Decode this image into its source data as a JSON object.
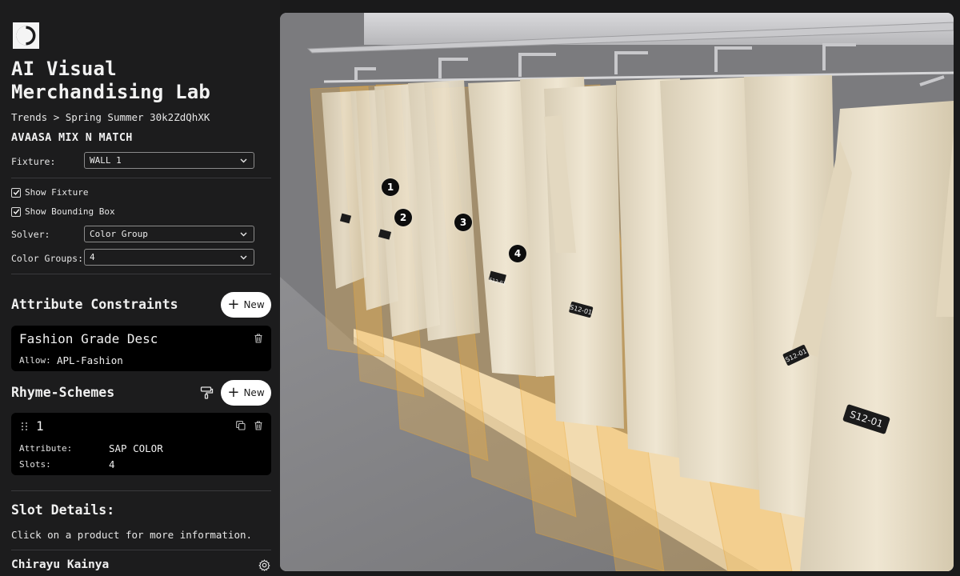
{
  "app": {
    "title": "AI Visual Merchandising Lab",
    "logo_icon": "half-circle-logo"
  },
  "breadcrumb": {
    "parent": "Trends",
    "separator": ">",
    "current": "Spring Summer 30k2ZdQhXK"
  },
  "collection": {
    "name": "AVAASA MIX N MATCH"
  },
  "controls": {
    "fixture_label": "Fixture:",
    "fixture_value": "WALL 1",
    "show_fixture_label": "Show Fixture",
    "show_fixture_checked": true,
    "show_bbox_label": "Show Bounding Box",
    "show_bbox_checked": true,
    "solver_label": "Solver:",
    "solver_value": "Color Group",
    "color_groups_label": "Color Groups:",
    "color_groups_value": "4"
  },
  "attribute_constraints": {
    "title": "Attribute Constraints",
    "new_label": "New",
    "items": [
      {
        "name": "Fashion Grade Desc",
        "allow_label": "Allow:",
        "allow_value": "APL-Fashion"
      }
    ]
  },
  "rhyme_schemes": {
    "title": "Rhyme-Schemes",
    "new_label": "New",
    "items": [
      {
        "index": "1",
        "attribute_label": "Attribute:",
        "attribute_value": "SAP COLOR",
        "slots_label": "Slots:",
        "slots_value": "4"
      }
    ]
  },
  "slot_details": {
    "title": "Slot Details:",
    "hint": "Click on a product for more information."
  },
  "user": {
    "name": "Chirayu Kainya"
  },
  "viewport": {
    "markers": [
      "1",
      "2",
      "3",
      "4"
    ],
    "tags": [
      "S12-01",
      "S12-01",
      "S12-01",
      "S12-01"
    ],
    "colors": {
      "bbox": "#f5b94a",
      "garment": "#e8dcc3",
      "floor": "#8a8a8d"
    }
  }
}
